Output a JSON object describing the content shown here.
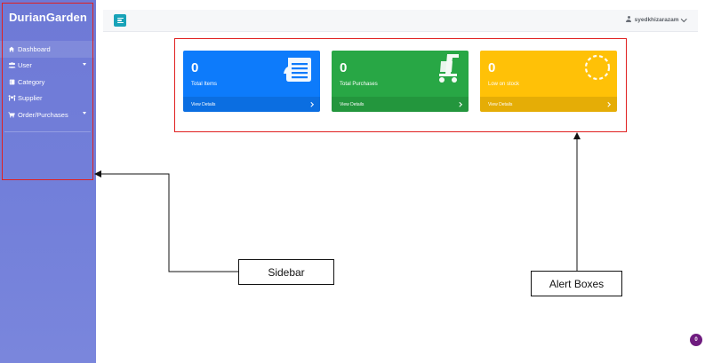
{
  "brand": {
    "title": "DurianGarden"
  },
  "sidebar": {
    "items": [
      {
        "icon": "home-icon",
        "label": "Dashboard",
        "has_caret": false,
        "active": true
      },
      {
        "icon": "users-icon",
        "label": "User",
        "has_caret": true,
        "active": false
      },
      {
        "icon": "book-icon",
        "label": "Category",
        "has_caret": false,
        "active": false
      },
      {
        "icon": "people-carry-icon",
        "label": "Supplier",
        "has_caret": false,
        "active": false
      },
      {
        "icon": "cart-icon",
        "label": "Order/Purchases",
        "has_caret": true,
        "active": false
      }
    ]
  },
  "topbar": {
    "username": "syedkhizarazam"
  },
  "cards": [
    {
      "count": "0",
      "label": "Total Items",
      "footer": "View Details",
      "color": "#0d7bfb",
      "icon": "list-icon"
    },
    {
      "count": "0",
      "label": "Total Purchases",
      "footer": "View Details",
      "color": "#28a745",
      "icon": "cart-icon"
    },
    {
      "count": "0",
      "label": "Low on stock",
      "footer": "View Details",
      "color": "#ffc107",
      "icon": "circle-notch-icon"
    }
  ],
  "annotations": {
    "sidebar": "Sidebar",
    "alerts": "Alert Boxes"
  },
  "badge": {
    "value": "0"
  },
  "colors": {
    "sidebar": "#6e79d6",
    "highlight": "#e02020",
    "toggle": "#17a2b8",
    "badge": "#6f1c7f"
  }
}
